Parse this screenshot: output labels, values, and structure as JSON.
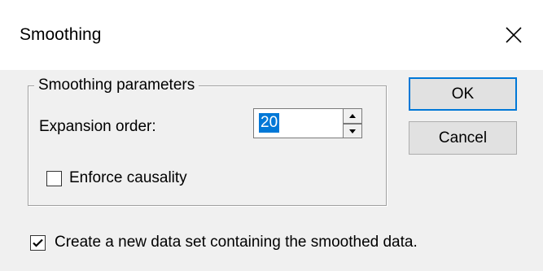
{
  "window": {
    "title": "Smoothing",
    "close_icon": "close-icon"
  },
  "group": {
    "label": "Smoothing parameters",
    "expansion_order_label": "Expansion order:",
    "expansion_order_value": "20",
    "enforce_causality_label": "Enforce causality",
    "enforce_causality_checked": false
  },
  "create_dataset": {
    "label": "Create a new data set containing the smoothed data.",
    "checked": true
  },
  "buttons": {
    "ok_label": "OK",
    "cancel_label": "Cancel"
  },
  "colors": {
    "selection": "#0078d7",
    "default_button_border": "#0078d7",
    "dialog_background": "#f0f0f0"
  }
}
